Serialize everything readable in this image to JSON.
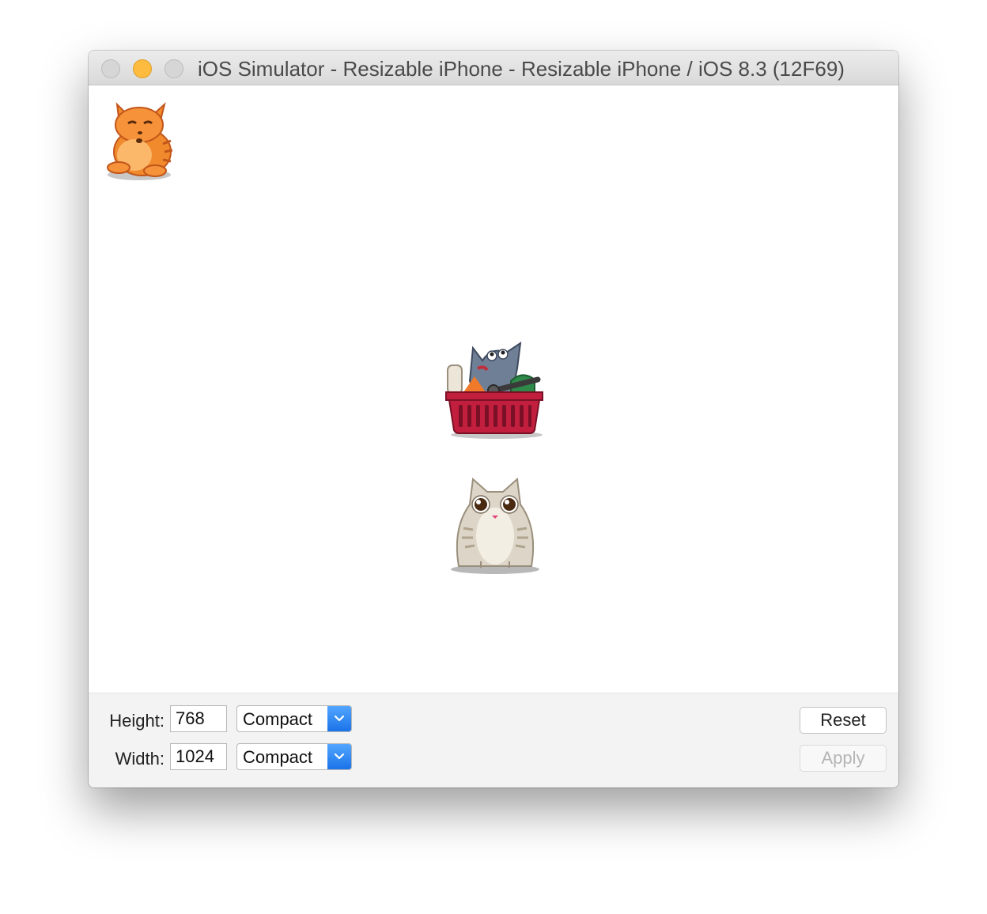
{
  "window": {
    "title": "iOS Simulator - Resizable iPhone - Resizable iPhone / iOS 8.3 (12F69)"
  },
  "traffic_lights": {
    "close_color": "#d6d6d6",
    "minimize_color": "#fdbc40",
    "maximize_color": "#d6d6d6"
  },
  "stickers": [
    {
      "name": "orange-cat-sticker-icon"
    },
    {
      "name": "gray-cat-in-shopping-basket-icon"
    },
    {
      "name": "beige-cat-sticker-icon"
    }
  ],
  "controls": {
    "height_label": "Height:",
    "height_value": "768",
    "height_size_class": "Compact",
    "width_label": "Width:",
    "width_value": "1024",
    "width_size_class": "Compact",
    "reset_label": "Reset",
    "apply_label": "Apply",
    "accent_color": "#1a73e8"
  }
}
